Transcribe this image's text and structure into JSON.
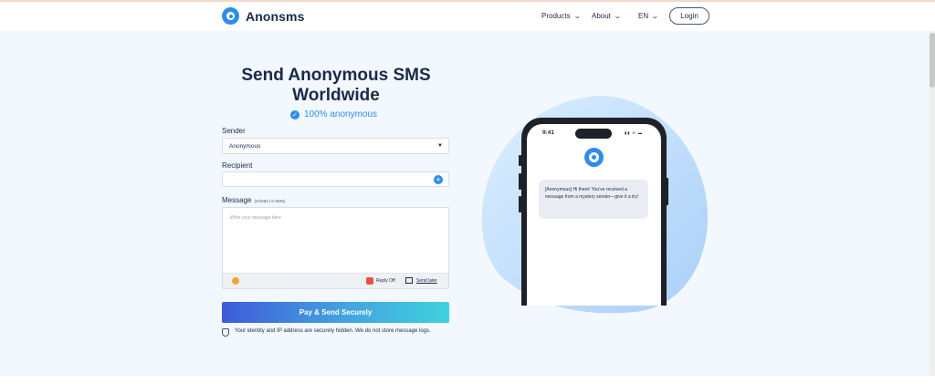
{
  "header": {
    "brand": "Anonsms",
    "nav": [
      {
        "label": "Products",
        "chevron": "chevron-down-icon"
      },
      {
        "label": "About",
        "chevron": "chevron-down-icon"
      },
      {
        "label": "EN",
        "chevron": "chevron-down-icon"
      }
    ],
    "login_label": "Login"
  },
  "hero": {
    "title_line1": "Send Anonymous SMS",
    "title_line2": "Worldwide",
    "badge": "100% anonymous"
  },
  "form": {
    "sender_label": "Sender",
    "sender_value": "Anonymous",
    "recipient_label": "Recipient",
    "recipient_value": "",
    "message_label": "Message",
    "message_counter": "(0/1083 | 0 SMS)",
    "message_placeholder": "Write your message here",
    "reply_label": "Reply Off",
    "send_later_label": "Send later",
    "pay_button": "Pay & Send Securely",
    "privacy_note": "Your identity and IP address are securely hidden. We do not store message logs."
  },
  "phone": {
    "time": "9:41",
    "message": "[Anonymous] Hi there! You've received a message from a mystery sender—give it a try!"
  },
  "colors": {
    "accent": "#2e8cf0",
    "navy": "#1b2a4a",
    "hero_bg": "#f2f8fd",
    "button_gradient_start": "#3e5bd9",
    "button_gradient_end": "#3fd1de"
  }
}
